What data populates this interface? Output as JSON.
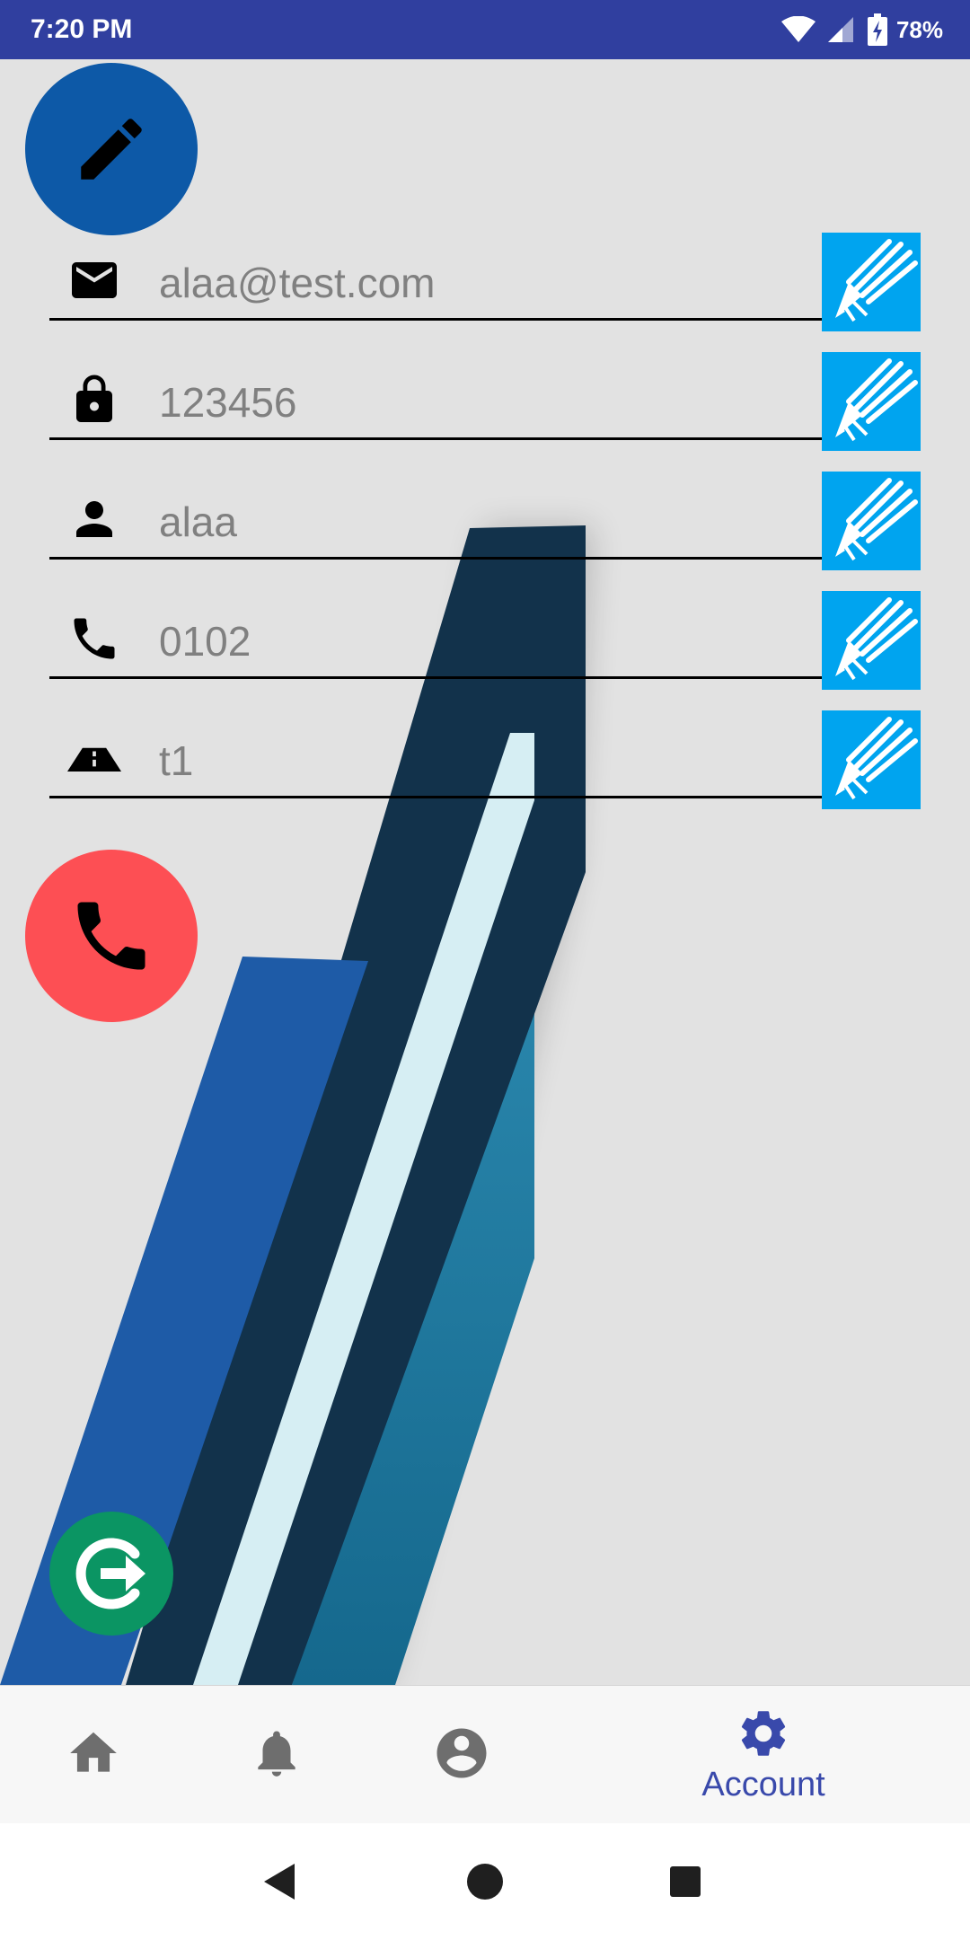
{
  "status_bar": {
    "time": "7:20 PM",
    "battery": "78%",
    "color": "#303f9f"
  },
  "profile": {
    "fields": [
      {
        "icon": "email-icon",
        "value": "alaa@test.com"
      },
      {
        "icon": "lock-icon",
        "value": "123456"
      },
      {
        "icon": "person-icon",
        "value": "alaa"
      },
      {
        "icon": "phone-icon",
        "value": "0102"
      },
      {
        "icon": "road-icon",
        "value": "t1"
      }
    ]
  },
  "bottom_nav": {
    "items": [
      {
        "icon": "home-icon",
        "label": ""
      },
      {
        "icon": "bell-icon",
        "label": ""
      },
      {
        "icon": "account-circle-icon",
        "label": ""
      },
      {
        "icon": "gear-icon",
        "label": "Account",
        "selected": true
      }
    ],
    "accent_color": "#3949ab"
  },
  "colors": {
    "edit_fab": "#0d59a7",
    "call_fab": "#fd4f54",
    "logout_fab": "#0b9563",
    "field_edit_button": "#00a4ef"
  }
}
